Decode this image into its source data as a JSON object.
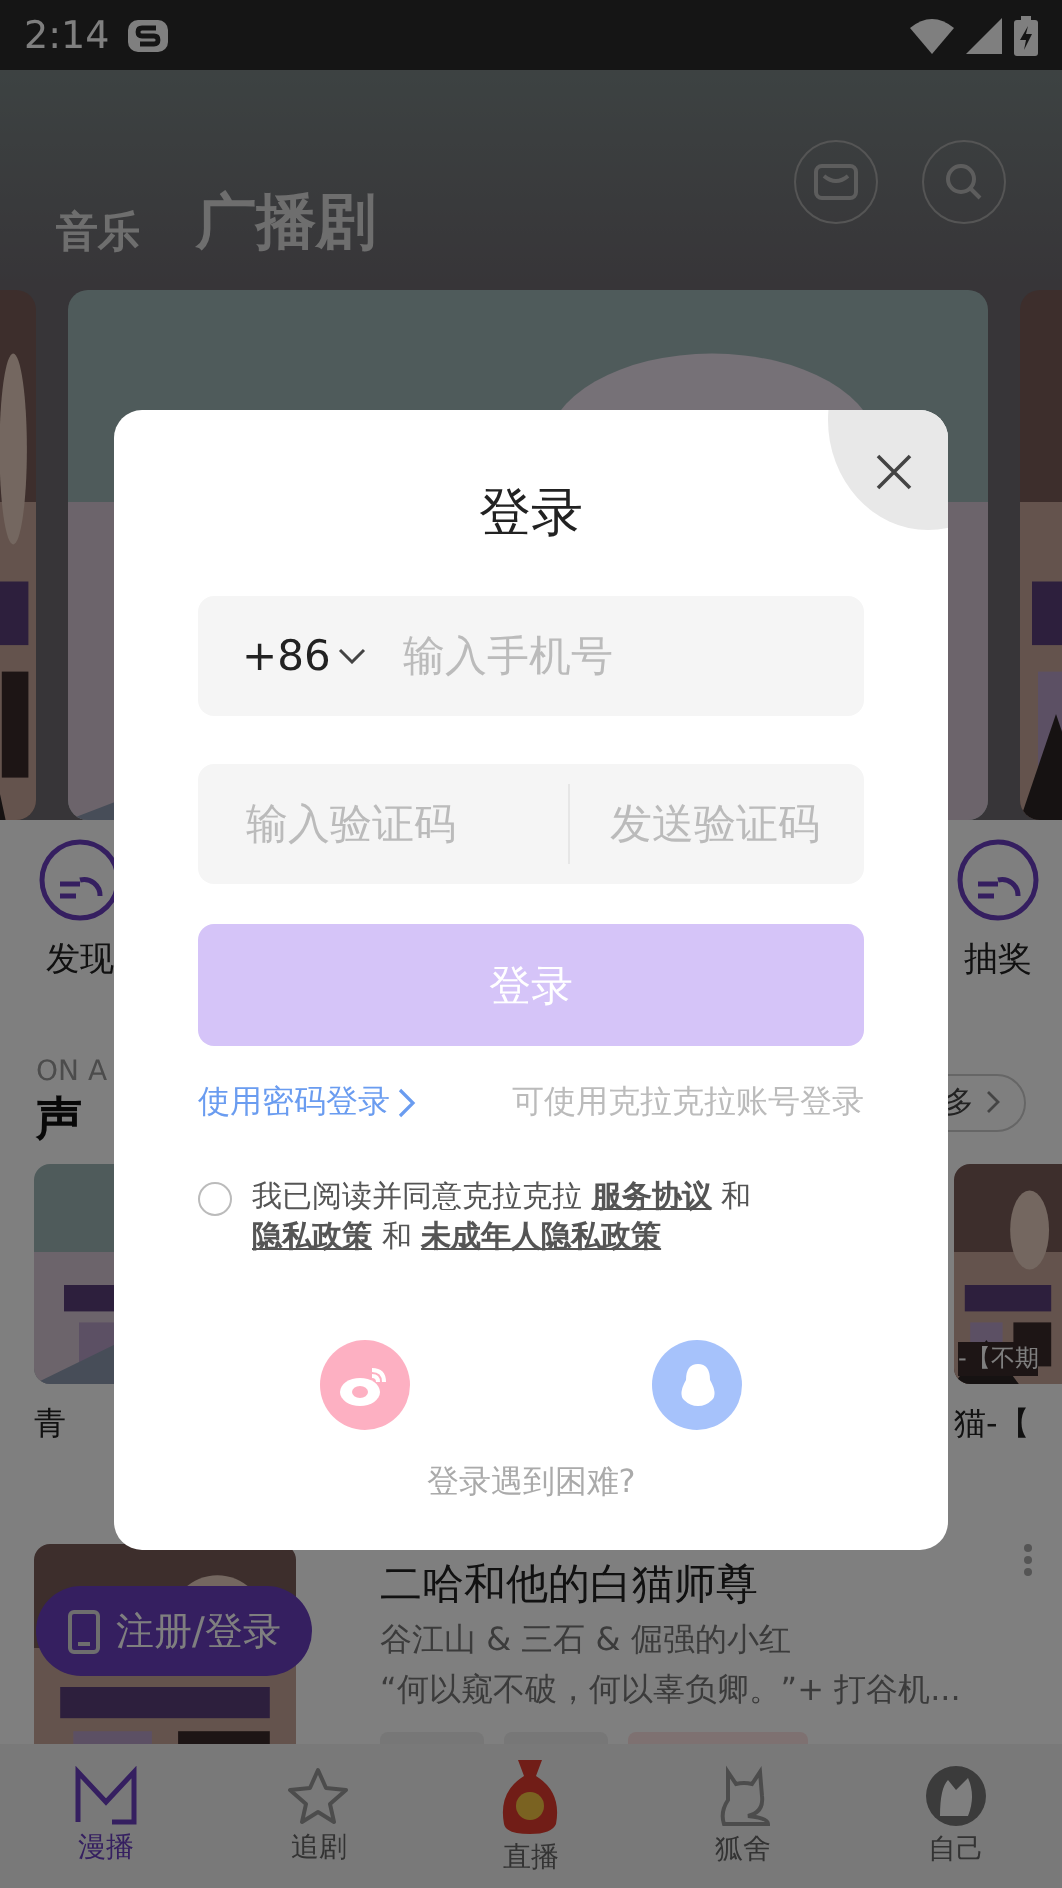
{
  "status_bar": {
    "time": "2:14"
  },
  "header": {
    "tabs": [
      {
        "label": "音乐",
        "selected": false
      },
      {
        "label": "广播剧",
        "selected": true
      }
    ]
  },
  "shortcuts": [
    "发现",
    "抽奖"
  ],
  "section": {
    "subtitle": "ON A",
    "title": "声",
    "more": "多"
  },
  "cards": [
    {
      "title": "青"
    },
    {
      "title": "猫-【",
      "caption": "-【不期"
    }
  ],
  "drama": {
    "title": "二哈和他的白猫师尊",
    "authors": "谷江山 & 三石 & 倔强的小红",
    "summary": "“何以窥不破，何以辜负卿。”+  打谷机..."
  },
  "register_button": "注册/登录",
  "nav": [
    {
      "label": "漫播",
      "selected": true
    },
    {
      "label": "追剧",
      "selected": false
    },
    {
      "label": "直播",
      "selected": false
    },
    {
      "label": "狐舍",
      "selected": false
    },
    {
      "label": "自己",
      "selected": false
    }
  ],
  "login_dialog": {
    "title": "登录",
    "country_code": "+86",
    "phone_placeholder": "输入手机号",
    "code_placeholder": "输入验证码",
    "send_code": "发送验证码",
    "submit": {
      "label": "登录",
      "disabled": true
    },
    "password_login": "使用密码登录",
    "account_hint": "可使用克拉克拉账号登录",
    "agreement": {
      "checked": false,
      "parts": [
        {
          "kind": "text",
          "text": "我已阅读并同意克拉克拉 "
        },
        {
          "kind": "link",
          "text": "服务协议"
        },
        {
          "kind": "text",
          "text": " 和 "
        },
        {
          "kind": "link",
          "text": "隐私政策"
        },
        {
          "kind": "text",
          "text": " 和 "
        },
        {
          "kind": "link",
          "text": "未成年人隐私政策"
        }
      ]
    },
    "help": "登录遇到困难?"
  }
}
